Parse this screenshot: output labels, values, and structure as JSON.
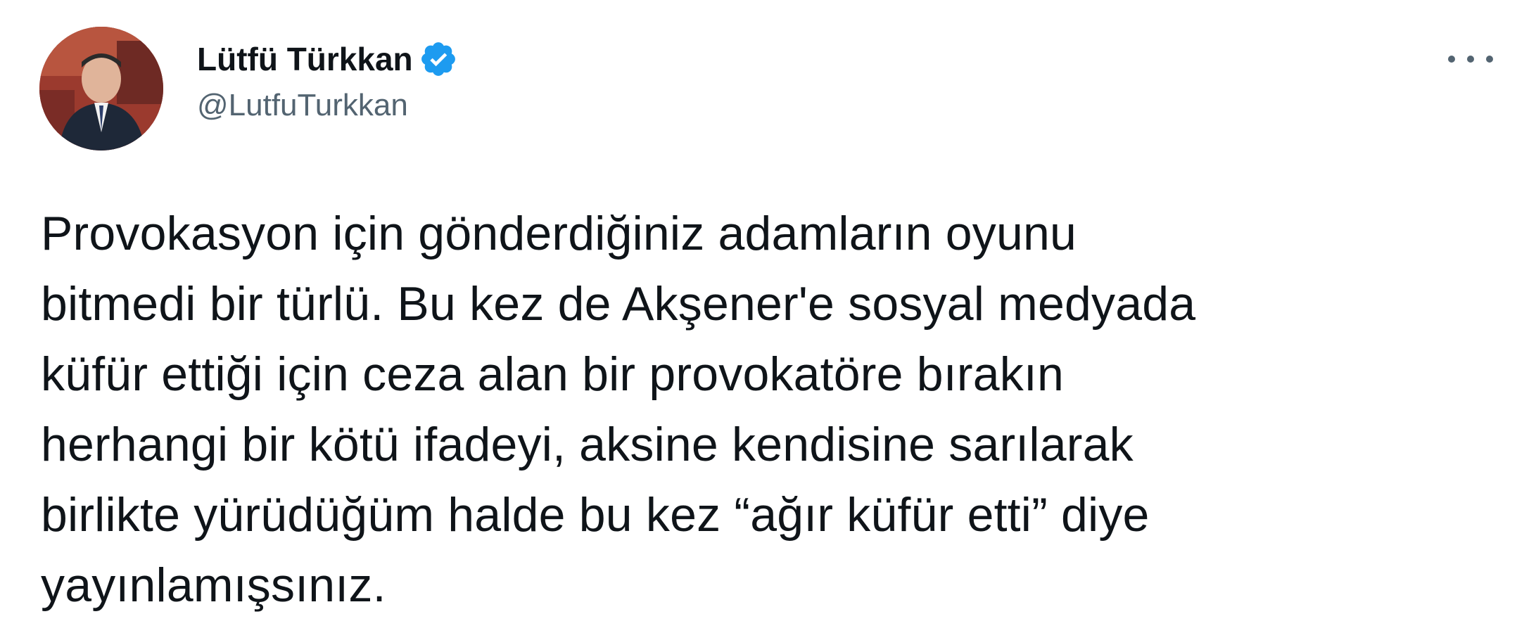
{
  "tweet": {
    "author": {
      "display_name": "Lütfü Türkkan",
      "handle": "@LutfuTurkkan",
      "verified": true,
      "verified_icon": "verified-badge-icon"
    },
    "more_icon": "more-options-icon",
    "text": "Provokasyon için gönderdiğiniz adamların oyunu\nbitmedi bir türlü.  Bu kez de Akşener'e sosyal medyada\nküfür ettiği için ceza alan bir provokatöre bırakın\nherhangi bir kötü ifadeyi, aksine kendisine sarılarak\nbirlikte yürüdüğüm halde bu kez “ağır küfür etti” diye\nyayınlamışsınız."
  },
  "colors": {
    "text": "#0f1419",
    "secondary": "#536471",
    "verified": "#1d9bf0",
    "background": "#ffffff"
  }
}
